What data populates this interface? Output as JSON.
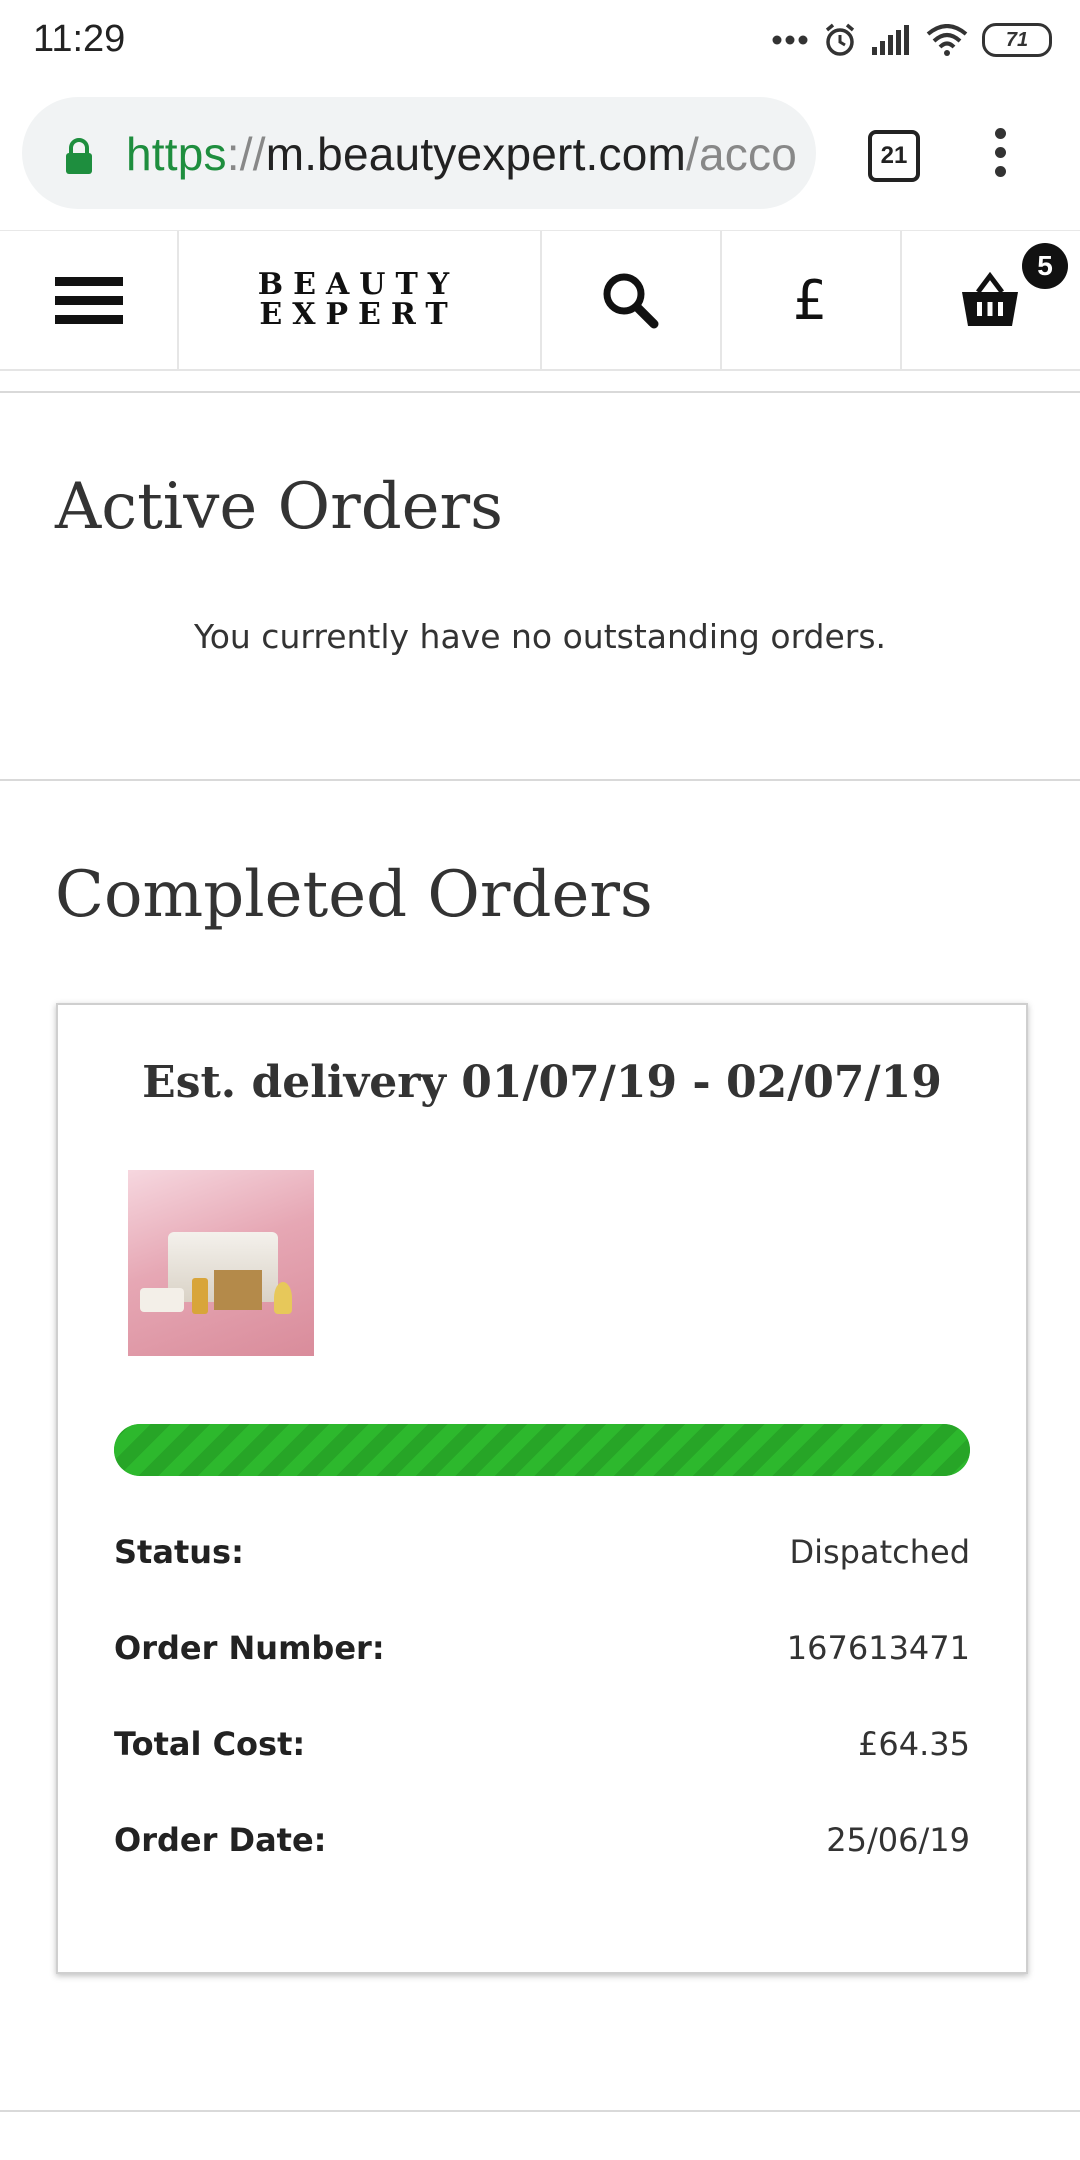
{
  "status_bar": {
    "time": "11:29",
    "battery_level": "71"
  },
  "browser": {
    "url_scheme": "https",
    "url_separator": "://",
    "url_host": "m.beautyexpert.com",
    "url_path": "/acco",
    "tab_count": "21"
  },
  "header": {
    "logo_line1": "BEAUTY",
    "logo_line2": "EXPERT",
    "currency_symbol": "£",
    "basket_count": "5"
  },
  "active_orders": {
    "title": "Active Orders",
    "empty_message": "You currently have no outstanding orders."
  },
  "completed_orders": {
    "title": "Completed Orders",
    "order": {
      "delivery_estimate": "Est. delivery 01/07/19 - 02/07/19",
      "progress": 1.0,
      "progress_color": "#2db82d",
      "status_label": "Status:",
      "status_value": "Dispatched",
      "order_number_label": "Order Number:",
      "order_number_value": "167613471",
      "total_cost_label": "Total Cost:",
      "total_cost_value": "£64.35",
      "order_date_label": "Order Date:",
      "order_date_value": "25/06/19"
    }
  }
}
